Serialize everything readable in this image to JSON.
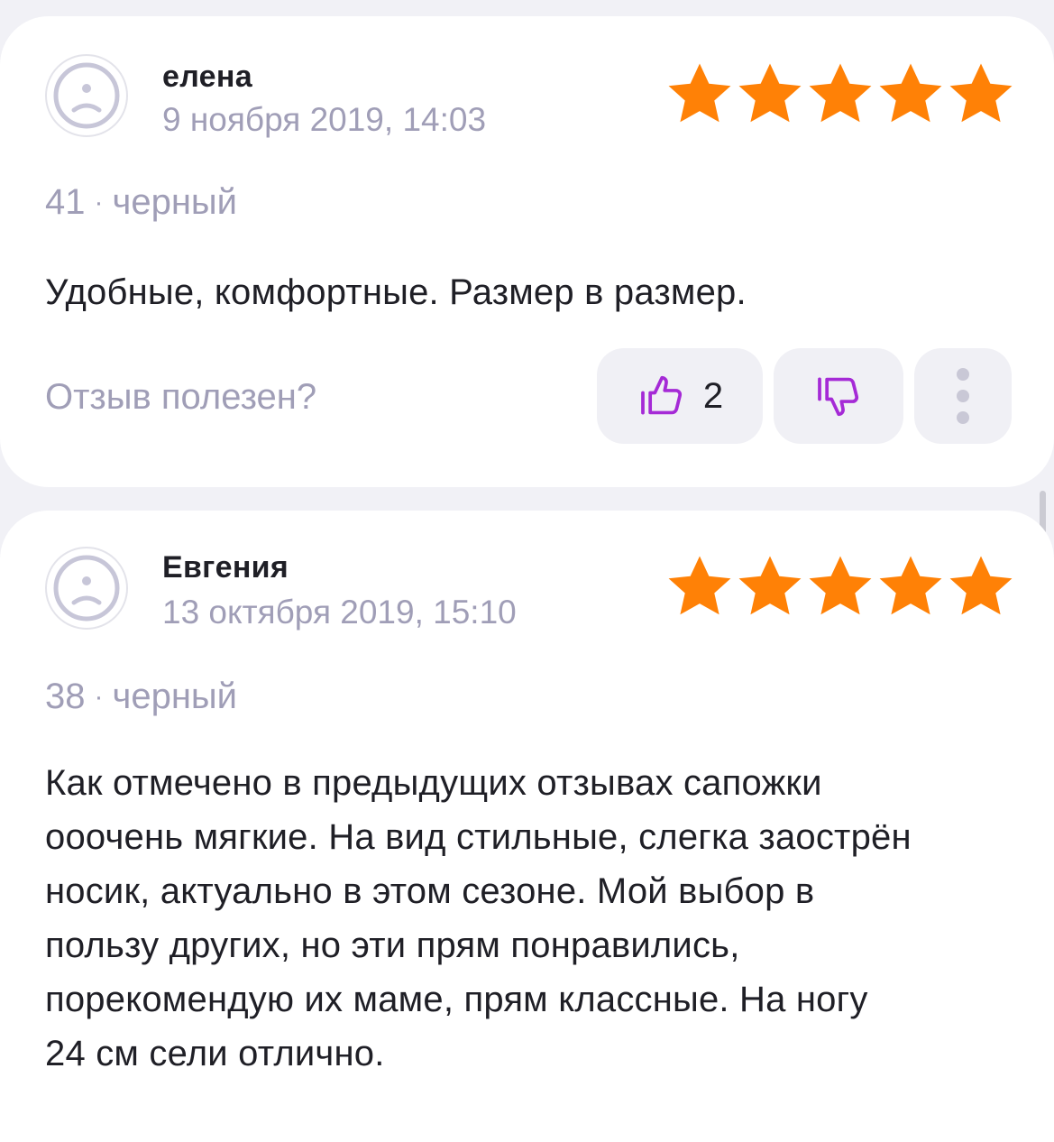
{
  "theme": {
    "star_color": "#ff8106",
    "reaction_icon_color": "#a52ad6",
    "muted_text_color": "#a09eb7"
  },
  "reviews": [
    {
      "author": "елена",
      "date": "9 ноября 2019, 14:03",
      "rating": 5,
      "size": "41",
      "separator": "·",
      "color": "черный",
      "text": "Удобные, комфортные. Размер в размер.",
      "helpful_label": "Отзыв полезен?",
      "likes": "2"
    },
    {
      "author": "Евгения",
      "date": "13 октября 2019, 15:10",
      "rating": 5,
      "size": "38",
      "separator": "·",
      "color": "черный",
      "text_lines": [
        "Как отмечено в предыдущих отзывах сапожки",
        "ооочень мягкие. На вид стильные, слегка заострён",
        "носик, актуально в этом сезоне. Мой выбор в",
        "пользу других, но эти прям понравились,",
        "порекомендую их маме, прям классные. На ногу",
        "24 см сели отлично."
      ]
    }
  ]
}
